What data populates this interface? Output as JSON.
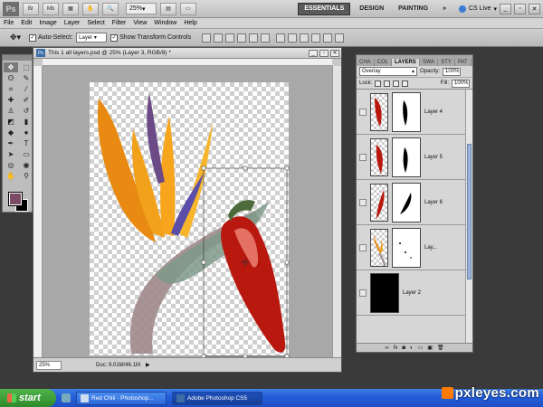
{
  "app": {
    "logo": "Ps",
    "zoom": "25%",
    "workspaces": [
      "ESSENTIALS",
      "DESIGN",
      "PAINTING"
    ],
    "more": "»",
    "cs_live": "CS Live"
  },
  "menu": [
    "File",
    "Edit",
    "Image",
    "Layer",
    "Select",
    "Filter",
    "View",
    "Window",
    "Help"
  ],
  "options": {
    "auto_select_label": "Auto-Select:",
    "auto_select_value": "Layer",
    "show_transform_label": "Show Transform Controls"
  },
  "document": {
    "title": "This 1 all layers.psd @ 25% (Layer 3, RGB/8) *",
    "zoom": "25%",
    "doc_size": "Doc: 9.01M/46.1M"
  },
  "layers_panel": {
    "tabs": [
      "CHA",
      "COL",
      "LAYERS",
      "SWA",
      "STY",
      "PAT"
    ],
    "active_tab": "LAYERS",
    "blend_mode": "Overlay",
    "opacity_label": "Opacity:",
    "opacity": "100%",
    "lock_label": "Lock:",
    "fill_label": "Fill:",
    "fill": "100%",
    "layers": [
      {
        "name": "Layer 4"
      },
      {
        "name": "Layer 5"
      },
      {
        "name": "Layer 6"
      },
      {
        "name": "Lay..."
      },
      {
        "name": "Layer 2"
      }
    ]
  },
  "taskbar": {
    "start": "start",
    "tasks": [
      "Red Chili - Photoshop...",
      "Adobe Photoshop CS5"
    ]
  },
  "watermark": "pxleyes.com",
  "colors": {
    "foreground": "#7b4a65",
    "background": "#000000",
    "taskbar": "#245edb"
  }
}
